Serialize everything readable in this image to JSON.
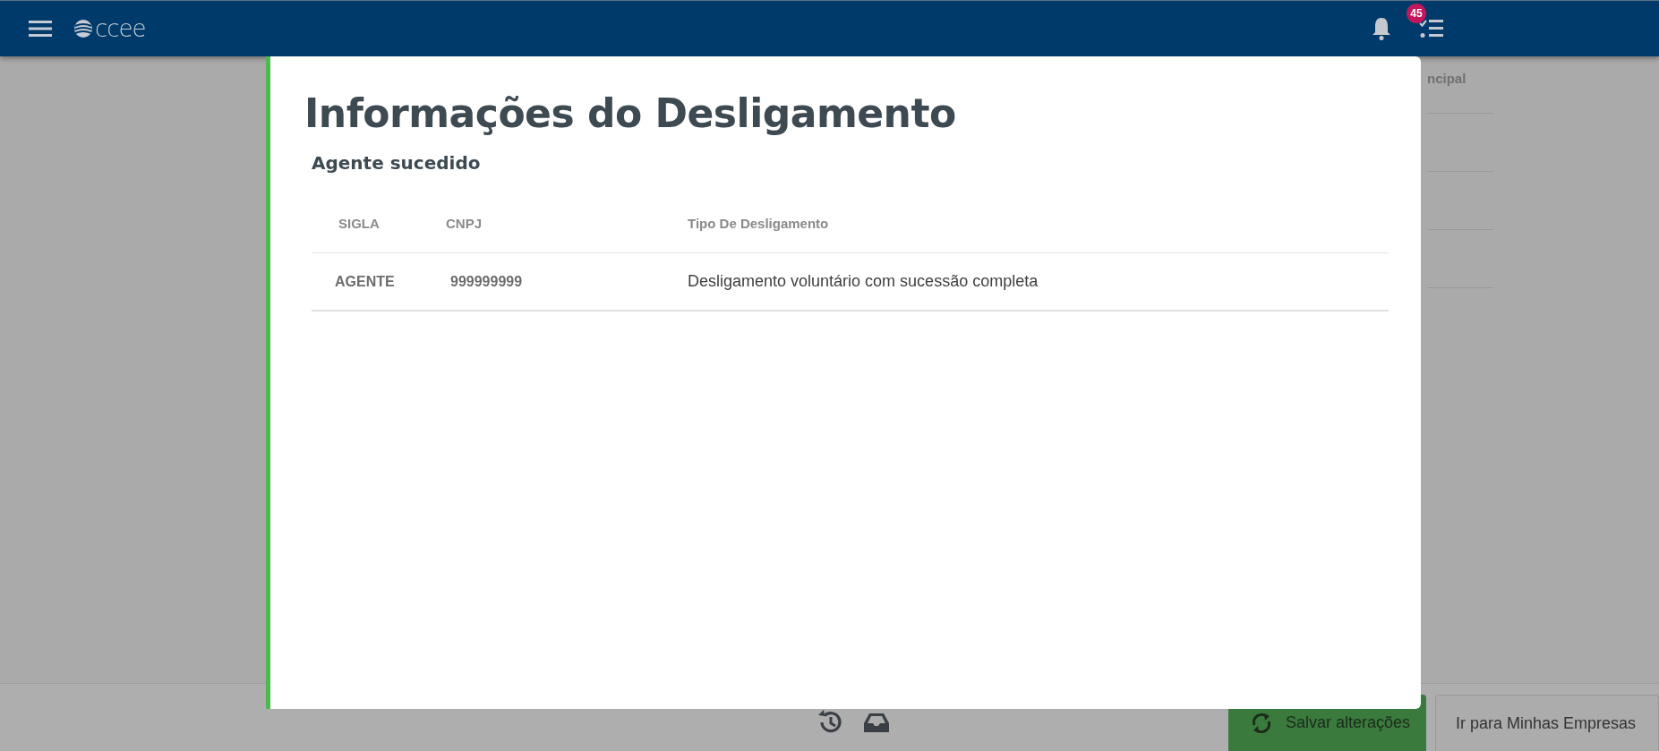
{
  "header": {
    "logo_text": "ccee",
    "badge": "45"
  },
  "background": {
    "column_header": "ncipal"
  },
  "modal": {
    "title": "Informações do Desligamento",
    "subtitle": "Agente sucedido",
    "table": {
      "columns": [
        "SIGLA",
        "CNPJ",
        "Tipo De Desligamento"
      ],
      "rows": [
        {
          "cells": [
            "AGENTE",
            "999999999",
            "Desligamento voluntário com sucessão completa"
          ]
        }
      ]
    }
  },
  "footer": {
    "buttons": [
      {
        "label": "Salvar alterações",
        "kind": "primary"
      },
      {
        "label": "Ir para Minhas Empresas",
        "kind": "secondary"
      }
    ]
  }
}
